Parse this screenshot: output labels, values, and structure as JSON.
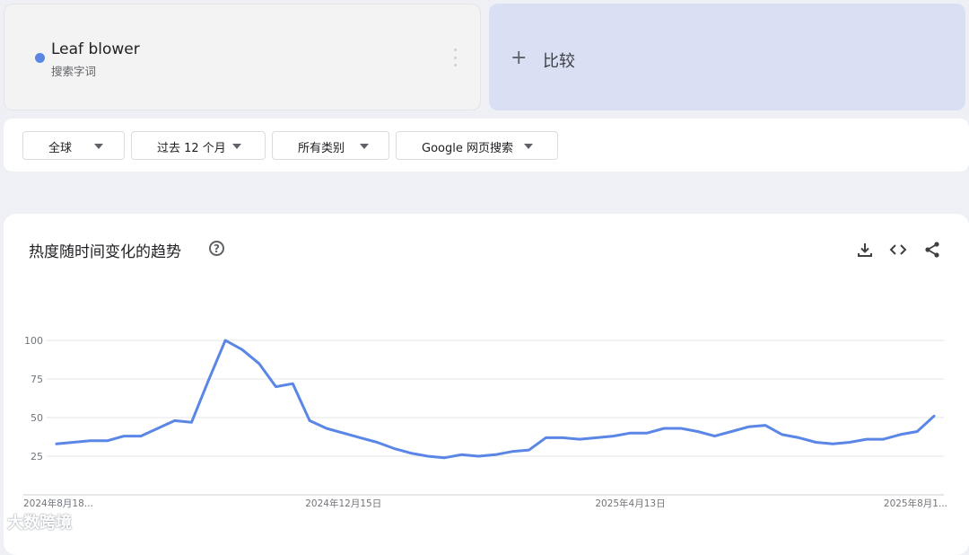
{
  "search_term": {
    "name": "Leaf blower",
    "type": "搜索字词",
    "color": "#5a86e6"
  },
  "compare": {
    "plus": "+",
    "label": "比较"
  },
  "filters": [
    {
      "label": "全球"
    },
    {
      "label": "过去 12 个月"
    },
    {
      "label": "所有类别"
    },
    {
      "label": "Google 网页搜索"
    }
  ],
  "chart_card": {
    "title": "热度随时间变化的趋势",
    "help": "?",
    "tools": [
      "download-icon",
      "embed-code-icon",
      "share-icon"
    ]
  },
  "watermark": "大数跨境",
  "chart_data": {
    "type": "line",
    "y_ticks": [
      25,
      50,
      75,
      100
    ],
    "ylim": [
      0,
      100
    ],
    "x_tick_labels": [
      "2024年8月18...",
      "2024年12月15日",
      "2025年4月13日",
      "2025年8月1..."
    ],
    "x_tick_index": [
      0,
      17,
      34,
      51
    ],
    "grid": true,
    "series": [
      {
        "color": "#5a86e6",
        "values": [
          33,
          34,
          35,
          35,
          38,
          38,
          43,
          48,
          47,
          74,
          100,
          94,
          85,
          70,
          72,
          48,
          43,
          40,
          37,
          34,
          30,
          27,
          25,
          24,
          26,
          25,
          26,
          28,
          29,
          37,
          37,
          36,
          37,
          38,
          40,
          40,
          43,
          43,
          41,
          38,
          41,
          44,
          45,
          39,
          37,
          34,
          33,
          34,
          36,
          36,
          39,
          41,
          51
        ]
      }
    ]
  }
}
